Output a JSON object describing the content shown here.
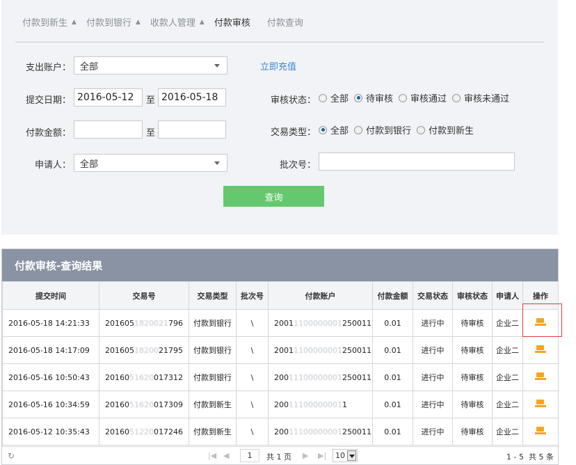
{
  "tabs": [
    {
      "label": "付款到新生",
      "arrow": "▲"
    },
    {
      "label": "付款到银行",
      "arrow": "▲"
    },
    {
      "label": "收款人管理",
      "arrow": "▲"
    },
    {
      "label": "付款审核",
      "arrow": ""
    },
    {
      "label": "付款查询",
      "arrow": ""
    }
  ],
  "form": {
    "account_label": "支出账户：",
    "account_value": "全部",
    "recharge_link": "立即充值",
    "date_label": "提交日期：",
    "date_from": "2016-05-12",
    "date_to": "2016-05-18",
    "to_label": "至",
    "amount_label": "付款金额：",
    "amount_from": "",
    "amount_to": "",
    "applicant_label": "申请人：",
    "applicant_value": "全部",
    "audit_status_label": "审核状态：",
    "audit_status_options": [
      "全部",
      "待审核",
      "审核通过",
      "审核未通过"
    ],
    "audit_status_selected": 1,
    "trade_type_label": "交易类型：",
    "trade_type_options": [
      "全部",
      "付款到银行",
      "付款到新生"
    ],
    "trade_type_selected": 0,
    "batch_label": "批次号：",
    "batch_value": "",
    "query_button": "查询"
  },
  "result": {
    "title": "付款审核-查询结果",
    "columns": [
      "提交时间",
      "交易号",
      "交易类型",
      "批次号",
      "付款账户",
      "付款金额",
      "交易状态",
      "审核状态",
      "申请人",
      "操作"
    ],
    "rows": [
      {
        "time": "2016-05-18 14:21:33",
        "trade_no_a": "201605",
        "trade_no_b": "1820021",
        "trade_no_c": "796",
        "type": "付款到银行",
        "batch": "\\",
        "acct_a": "2001",
        "acct_b": "1100000001",
        "acct_c": "250011",
        "amount": "0.01",
        "trade_status": "进行中",
        "audit_status": "待审核",
        "applicant": "企业二"
      },
      {
        "time": "2016-05-18 14:17:09",
        "trade_no_a": "201605",
        "trade_no_b": "18200",
        "trade_no_c": "21795",
        "type": "付款到银行",
        "batch": "\\",
        "acct_a": "2001",
        "acct_b": "1100000001",
        "acct_c": "250011",
        "amount": "0.01",
        "trade_status": "进行中",
        "audit_status": "待审核",
        "applicant": "企业二"
      },
      {
        "time": "2016-05-16 10:50:43",
        "trade_no_a": "20160",
        "trade_no_b": "51620",
        "trade_no_c": "017312",
        "type": "付款到银行",
        "batch": "\\",
        "acct_a": "200",
        "acct_b": "11100000001",
        "acct_c": "250011",
        "amount": "0.01",
        "trade_status": "进行中",
        "audit_status": "待审核",
        "applicant": "企业二"
      },
      {
        "time": "2016-05-16 10:34:59",
        "trade_no_a": "20160",
        "trade_no_b": "51620",
        "trade_no_c": "017309",
        "type": "付款到新生",
        "batch": "\\",
        "acct_a": "200",
        "acct_b": "11100000001",
        "acct_c": "1",
        "amount": "0.01",
        "trade_status": "进行中",
        "audit_status": "待审核",
        "applicant": "企业二"
      },
      {
        "time": "2016-05-12 10:35:43",
        "trade_no_a": "20160",
        "trade_no_b": "51220",
        "trade_no_c": "017246",
        "type": "付款到新生",
        "batch": "\\",
        "acct_a": "200",
        "acct_b": "11100000001",
        "acct_c": "250011",
        "amount": "0.01",
        "trade_status": "进行中",
        "audit_status": "待审核",
        "applicant": "企业二"
      }
    ]
  },
  "pager": {
    "first": "|◀",
    "prev": "◀",
    "page": "1",
    "total_pages": "共 1 页",
    "next": "▶",
    "last": "▶|",
    "page_size": "10",
    "summary": "1 - 5  共 5 条",
    "refresh_icon": "↻"
  }
}
